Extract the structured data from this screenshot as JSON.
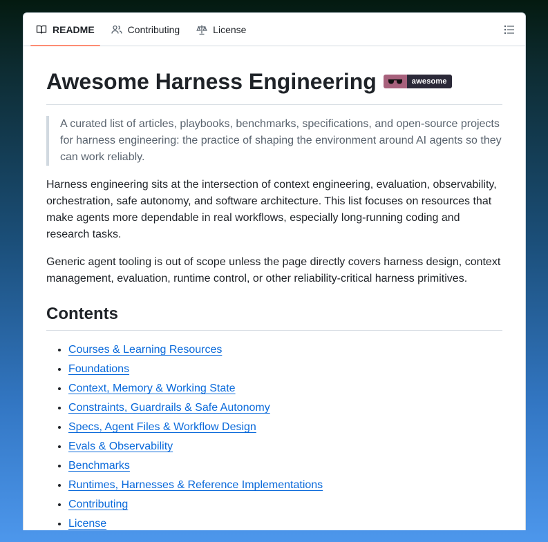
{
  "tabs": [
    {
      "label": "README",
      "icon": "book-icon",
      "active": true
    },
    {
      "label": "Contributing",
      "icon": "people-icon",
      "active": false
    },
    {
      "label": "License",
      "icon": "scale-icon",
      "active": false
    }
  ],
  "outline_icon": "list-icon",
  "title": "Awesome Harness Engineering",
  "badge": {
    "icon": "sunglasses-icon",
    "text": "awesome",
    "left_color": "#a7617c",
    "right_color": "#2b2938"
  },
  "blockquote": "A curated list of articles, playbooks, benchmarks, specifications, and open-source projects for harness engineering: the practice of shaping the environment around AI agents so they can work reliably.",
  "paragraphs": [
    "Harness engineering sits at the intersection of context engineering, evaluation, observability, orchestration, safe autonomy, and software architecture. This list focuses on resources that make agents more dependable in real workflows, especially long-running coding and research tasks.",
    "Generic agent tooling is out of scope unless the page directly covers harness design, context management, evaluation, runtime control, or other reliability-critical harness primitives."
  ],
  "contents_heading": "Contents",
  "contents": [
    "Courses & Learning Resources",
    "Foundations",
    "Context, Memory & Working State",
    "Constraints, Guardrails & Safe Autonomy",
    "Specs, Agent Files & Workflow Design",
    "Evals & Observability",
    "Benchmarks",
    "Runtimes, Harnesses & Reference Implementations",
    "Contributing",
    "License"
  ],
  "colors": {
    "accent_tab": "#fd8c73",
    "link": "#0969da",
    "text": "#1f2328",
    "muted": "#59636e"
  }
}
